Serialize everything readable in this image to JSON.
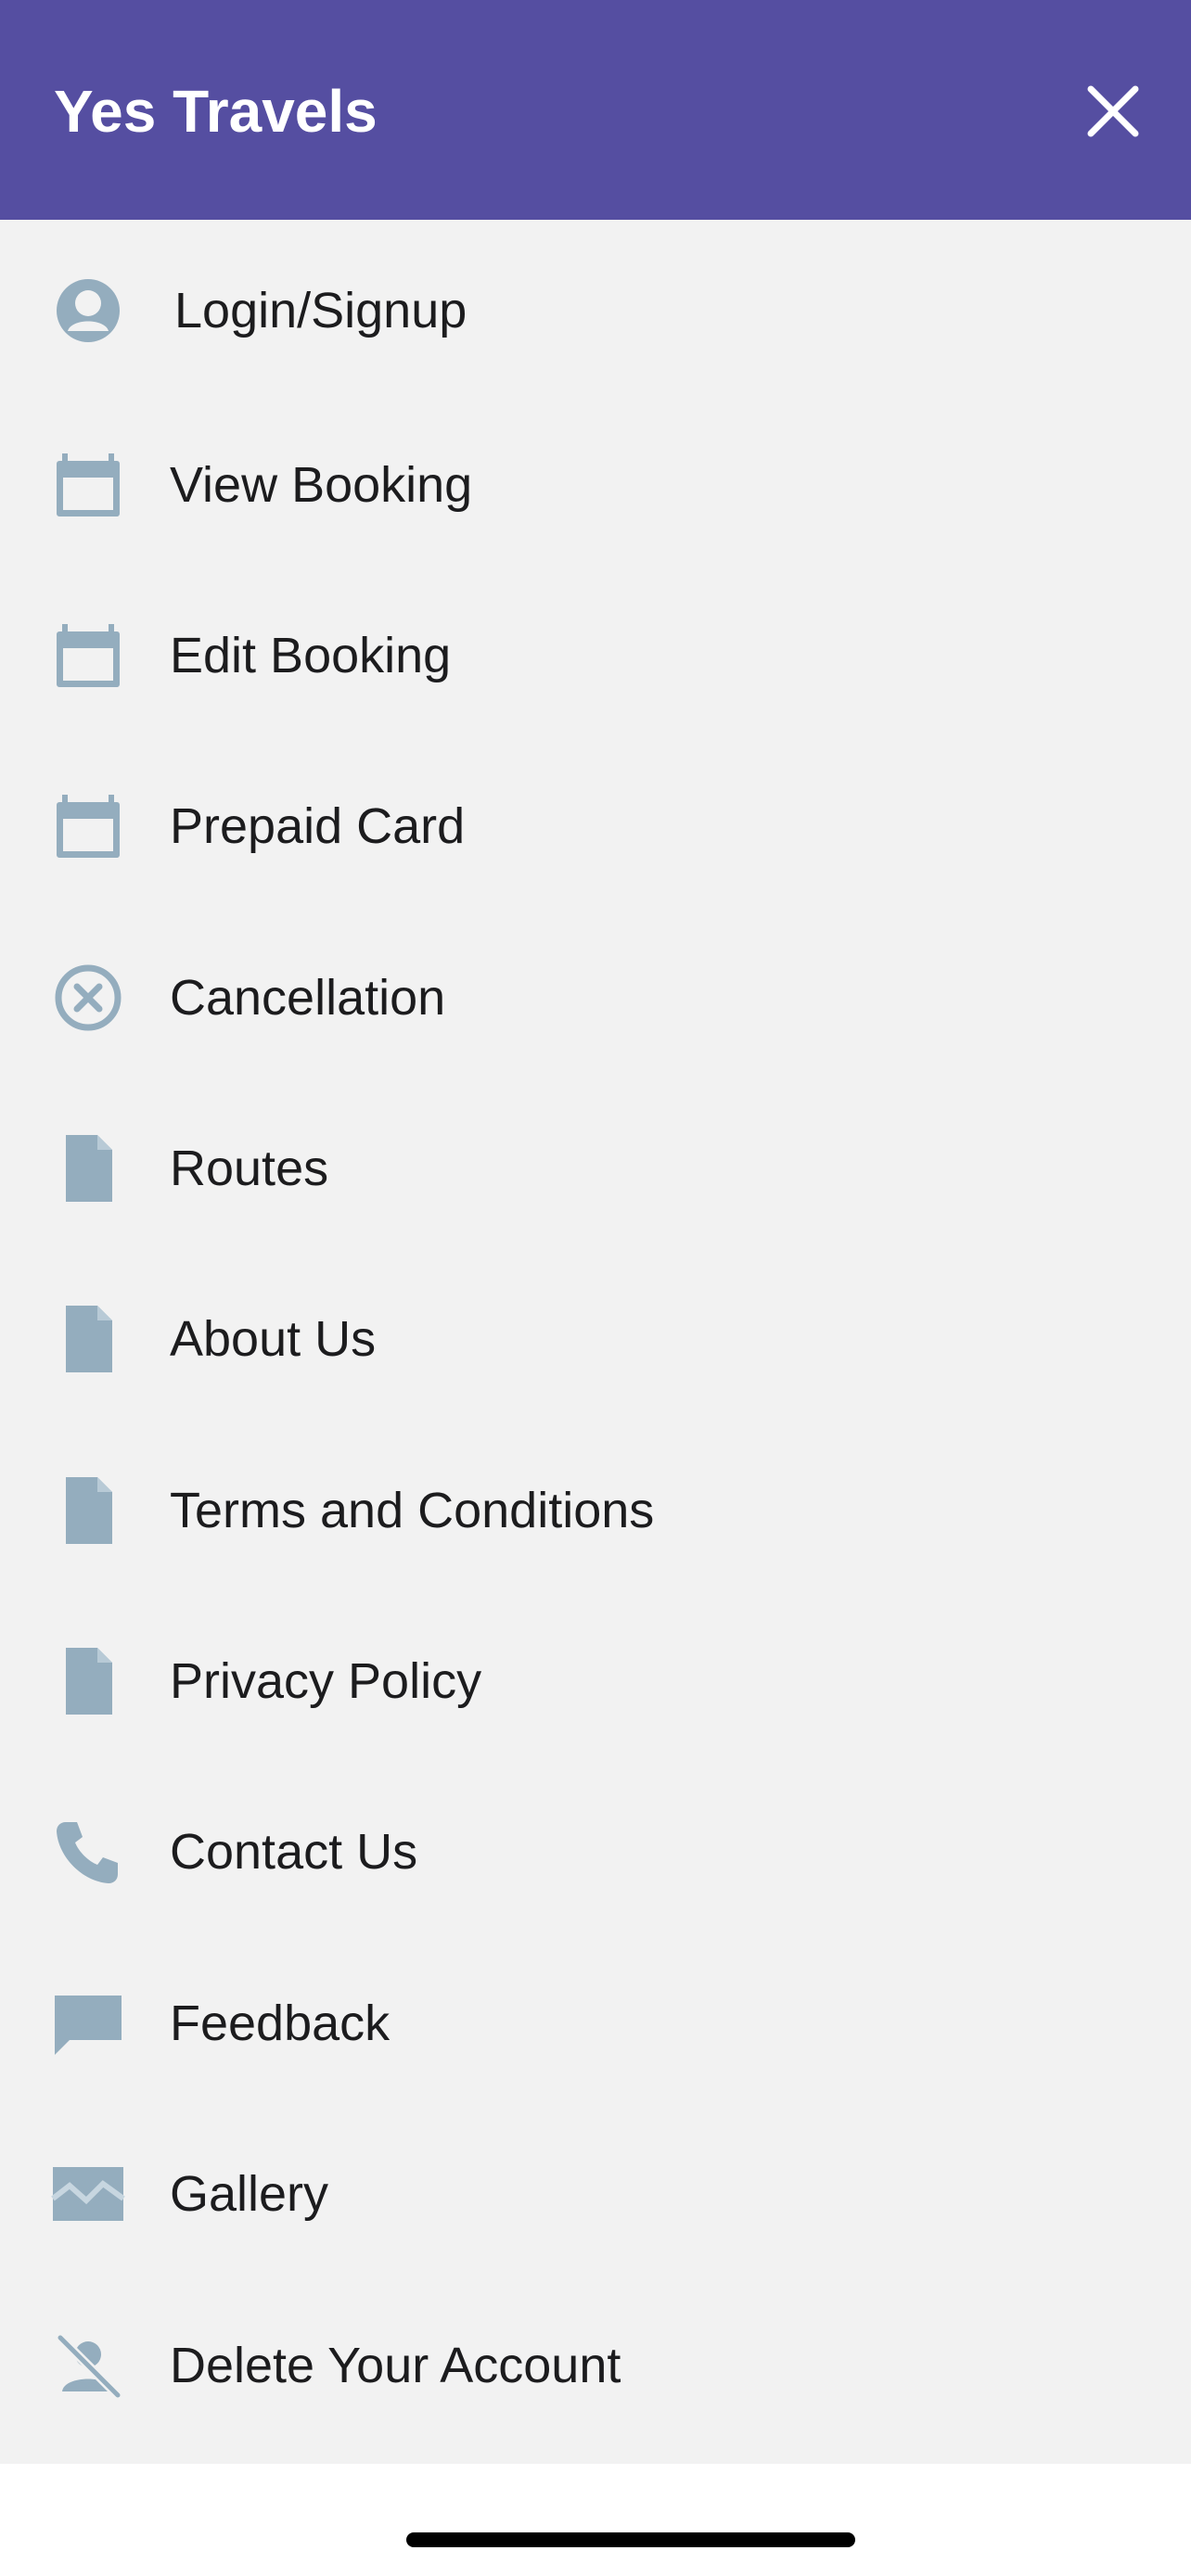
{
  "header": {
    "title": "Yes Travels",
    "close_icon": "close-icon"
  },
  "colors": {
    "header_bg": "#554ea1",
    "menu_bg": "#f2f2f2",
    "icon": "#94adbe",
    "text": "#1c1c1e"
  },
  "menu": {
    "items": [
      {
        "label": "Login/Signup",
        "icon": "user-icon"
      },
      {
        "label": "View Booking",
        "icon": "calendar-icon"
      },
      {
        "label": "Edit Booking",
        "icon": "calendar-icon"
      },
      {
        "label": "Prepaid Card",
        "icon": "calendar-icon"
      },
      {
        "label": "Cancellation",
        "icon": "cancel-circle-icon"
      },
      {
        "label": "Routes",
        "icon": "document-icon"
      },
      {
        "label": "About Us",
        "icon": "document-icon"
      },
      {
        "label": "Terms and Conditions",
        "icon": "document-icon"
      },
      {
        "label": "Privacy Policy",
        "icon": "document-icon"
      },
      {
        "label": "Contact Us",
        "icon": "phone-icon"
      },
      {
        "label": "Feedback",
        "icon": "chat-bubble-icon"
      },
      {
        "label": "Gallery",
        "icon": "image-icon"
      },
      {
        "label": "Delete Your Account",
        "icon": "user-off-icon"
      }
    ]
  }
}
